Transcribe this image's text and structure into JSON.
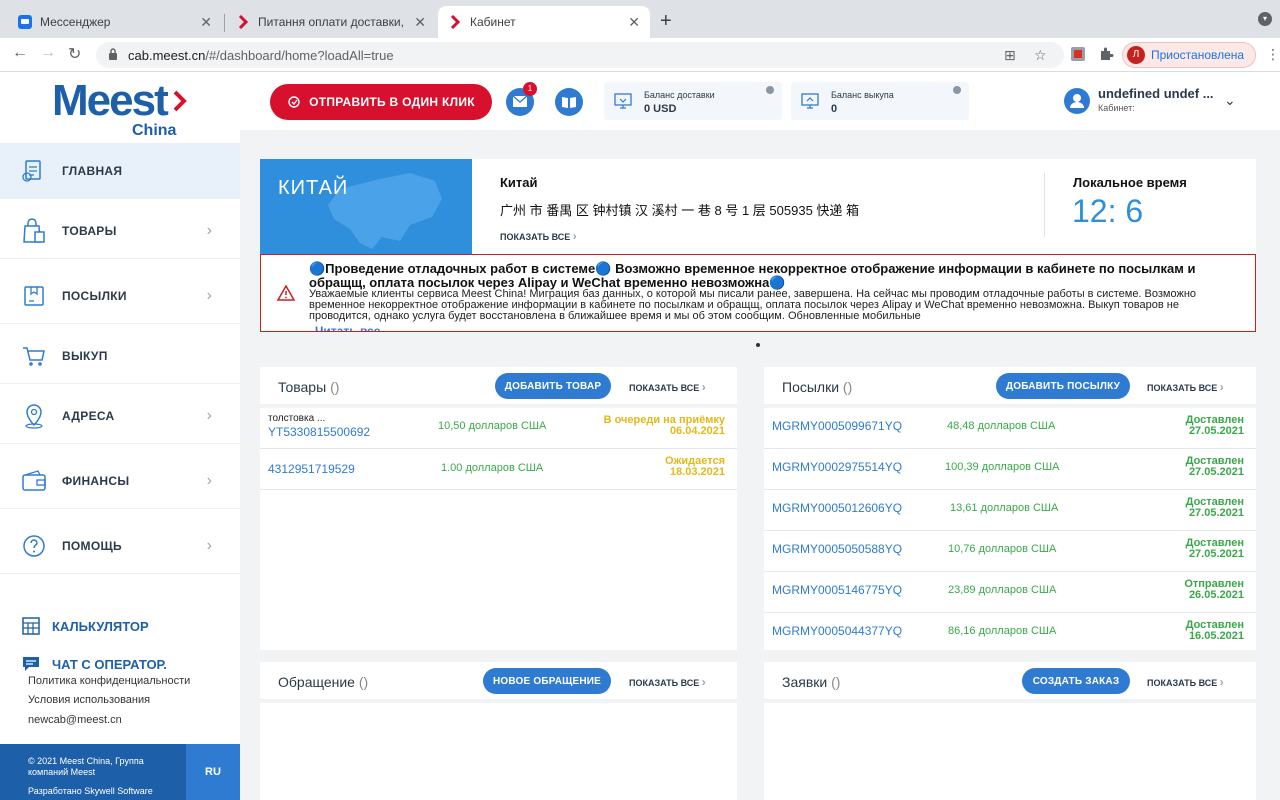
{
  "browser": {
    "tabs": [
      {
        "title": "Мессенджер"
      },
      {
        "title": "Питання оплати доставки, інс"
      },
      {
        "title": "Кабинет"
      }
    ],
    "url_host": "cab.meest.cn",
    "url_path": "/#/dashboard/home?loadAll=true",
    "profile_initial": "Л",
    "profile_label": "Приостановлена"
  },
  "sidebar": {
    "logo_text": "Meest",
    "logo_sub": "China",
    "items": [
      {
        "label": "ГЛАВНАЯ"
      },
      {
        "label": "ТОВАРЫ"
      },
      {
        "label": "ПОСЫЛКИ"
      },
      {
        "label": "ВЫКУП"
      },
      {
        "label": "АДРЕСА"
      },
      {
        "label": "ФИНАНСЫ"
      },
      {
        "label": "ПОМОЩЬ"
      }
    ],
    "calculator": "КАЛЬКУЛЯТОР",
    "chat": "ЧАТ С ОПЕРАТОР.",
    "privacy": "Политика конфиденциальности",
    "terms": "Условия использования",
    "email": "newcab@meest.cn",
    "copyright": "© 2021 Meest China, Группа компаний Meest",
    "developer": "Разработано Skywell Software",
    "lang": "RU"
  },
  "header": {
    "send_button": "ОТПРАВИТЬ В ОДИН КЛИК",
    "messages_badge": "1",
    "balance_delivery_label": "Баланс доставки",
    "balance_delivery_value": "0 USD",
    "balance_buyout_label": "Баланс выкупа",
    "balance_buyout_value": "0",
    "user_name": "undefined undef ...",
    "user_sub": "Кабинет:"
  },
  "location": {
    "map_label": "КИТАЙ",
    "title": "Китай",
    "address": "广州 市 番禺 区 钟村镇 汉 溪村 一 巷 8 号 1 层 505935 快递 箱",
    "show_all": "ПОКАЗАТЬ ВСЕ",
    "time_label": "Локальное время",
    "time_value": "12: 6"
  },
  "alert": {
    "heading": "🔵Проведение отладочных работ в системе🔵 Возможно временное некорректное отображение информации в кабинете по посылкам и обращщ, оплата посылок через Alipay и WeChat временно невозможна🔵",
    "body": "Уважаемые клиенты сервиса Meest China! Миграция баз данных, о которой мы писали ранее, завершена. На сейчас мы проводим отладочные работы в системе. Возможно временное некорректное отображение информации в кабинете по посылкам и обращщ, оплата посылок через Alipay и WeChat временно невозможна. Выкуп товаров не проводится, однако услуга будет восстановлена в ближайшее время и мы об этом сообщим. Обновленные мобильные",
    "read_more": "Читать все"
  },
  "goods": {
    "title": "Товары",
    "count": "()",
    "add_button": "ДОБАВИТЬ ТОВАР",
    "show_all": "ПОКАЗАТЬ ВСЕ",
    "rows": [
      {
        "sub": "толстовка ...",
        "code": "YT5330815500692",
        "amount": "10,50 долларов США",
        "status": "В очереди на приёмку",
        "date": "06.04.2021"
      },
      {
        "sub": "",
        "code": "4312951719529",
        "amount": "1.00 долларов США",
        "status": "Ожидается",
        "date": "18.03.2021"
      }
    ]
  },
  "parcels": {
    "title": "Посылки",
    "count": "()",
    "add_button": "ДОБАВИТЬ ПОСЫЛКУ",
    "show_all": "ПОКАЗАТЬ ВСЕ",
    "rows": [
      {
        "code": "MGRMY0005099671YQ",
        "amount": "48,48 долларов США",
        "status": "Доставлен",
        "date": "27.05.2021"
      },
      {
        "code": "MGRMY0002975514YQ",
        "amount": "100,39 долларов США",
        "status": "Доставлен",
        "date": "27.05.2021"
      },
      {
        "code": "MGRMY0005012606YQ",
        "amount": "13,61 долларов США",
        "status": "Доставлен",
        "date": "27.05.2021"
      },
      {
        "code": "MGRMY0005050588YQ",
        "amount": "10,76 долларов США",
        "status": "Доставлен",
        "date": "27.05.2021"
      },
      {
        "code": "MGRMY0005146775YQ",
        "amount": "23,89 долларов США",
        "status": "Отправлен",
        "date": "26.05.2021"
      },
      {
        "code": "MGRMY0005044377YQ",
        "amount": "86,16 долларов США",
        "status": "Доставлен",
        "date": "16.05.2021"
      }
    ]
  },
  "appeals": {
    "title": "Обращение",
    "count": "()",
    "add_button": "НОВОЕ ОБРАЩЕНИЕ",
    "show_all": "ПОКАЗАТЬ ВСЕ"
  },
  "orders": {
    "title": "Заявки",
    "count": "()",
    "add_button": "СОЗДАТЬ ЗАКАЗ",
    "show_all": "ПОКАЗАТЬ ВСЕ"
  },
  "colors": {
    "brand_blue": "#1d5fa8",
    "accent_blue": "#2f7bd1",
    "red": "#d7112d",
    "green": "#3aa84a",
    "yellow": "#e3b81a"
  }
}
